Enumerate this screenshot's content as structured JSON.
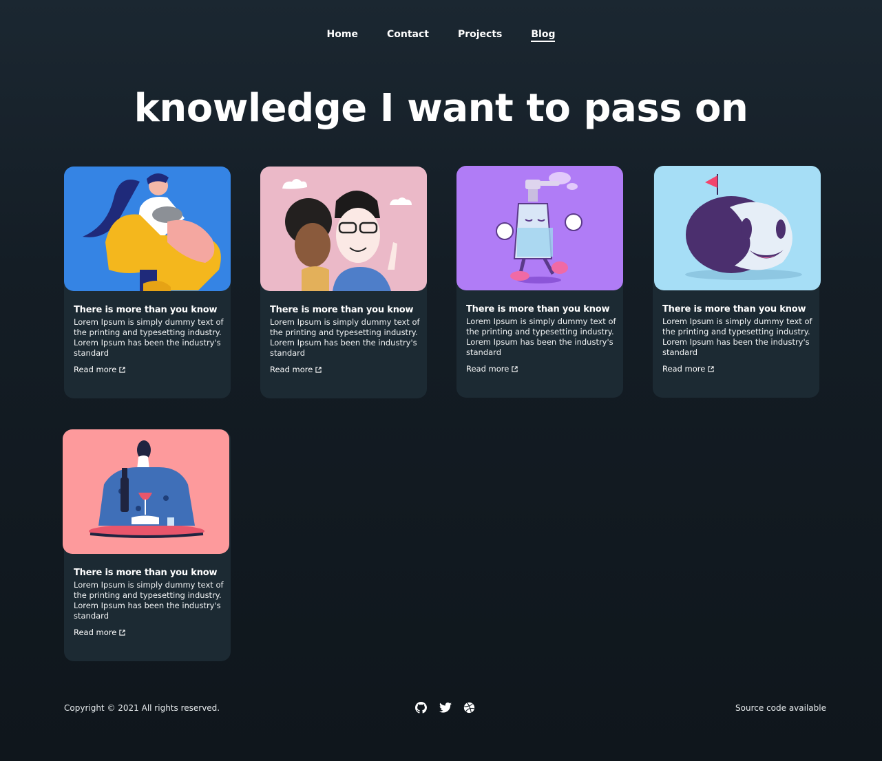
{
  "nav": {
    "items": [
      {
        "label": "Home",
        "active": false
      },
      {
        "label": "Contact",
        "active": false
      },
      {
        "label": "Projects",
        "active": false
      },
      {
        "label": "Blog",
        "active": true
      }
    ]
  },
  "hero": {
    "title": "knowledge I want to pass on"
  },
  "posts": [
    {
      "title": "There is more than you know",
      "text": "Lorem Ipsum is simply dummy text of the printing and typesetting industry. Lorem Ipsum has been the industry's standard",
      "link": "Read more",
      "image": "girl-with-cat-illustration",
      "bg": "#3584e4"
    },
    {
      "title": "There is more than you know",
      "text": "Lorem Ipsum is simply dummy text of the printing and typesetting industry. Lorem Ipsum has been the industry's standard",
      "link": "Read more",
      "image": "couple-selfie-illustration",
      "bg": "#ebb9c8"
    },
    {
      "title": "There is more than you know",
      "text": "Lorem Ipsum is simply dummy text of the printing and typesetting industry. Lorem Ipsum has been the industry's standard",
      "link": "Read more",
      "image": "soap-bottle-character-illustration",
      "bg": "#b07cf6"
    },
    {
      "title": "There is more than you know",
      "text": "Lorem Ipsum is simply dummy text of the printing and typesetting industry. Lorem Ipsum has been the industry's standard",
      "link": "Read more",
      "image": "smiling-blob-character-illustration",
      "bg": "#a6def6"
    },
    {
      "title": "There is more than you know",
      "text": "Lorem Ipsum is simply dummy text of the printing and typesetting industry. Lorem Ipsum has been the industry's standard",
      "link": "Read more",
      "image": "woman-with-wine-illustration",
      "bg": "#fd9a9c"
    }
  ],
  "footer": {
    "copyright": "Copyright © 2021 All rights reserved.",
    "source": "Source code available",
    "socials": [
      "github-icon",
      "twitter-icon",
      "dribbble-icon"
    ]
  },
  "colors": {
    "background": "#131c23",
    "card": "#1c2a33",
    "text": "#ffffff"
  }
}
